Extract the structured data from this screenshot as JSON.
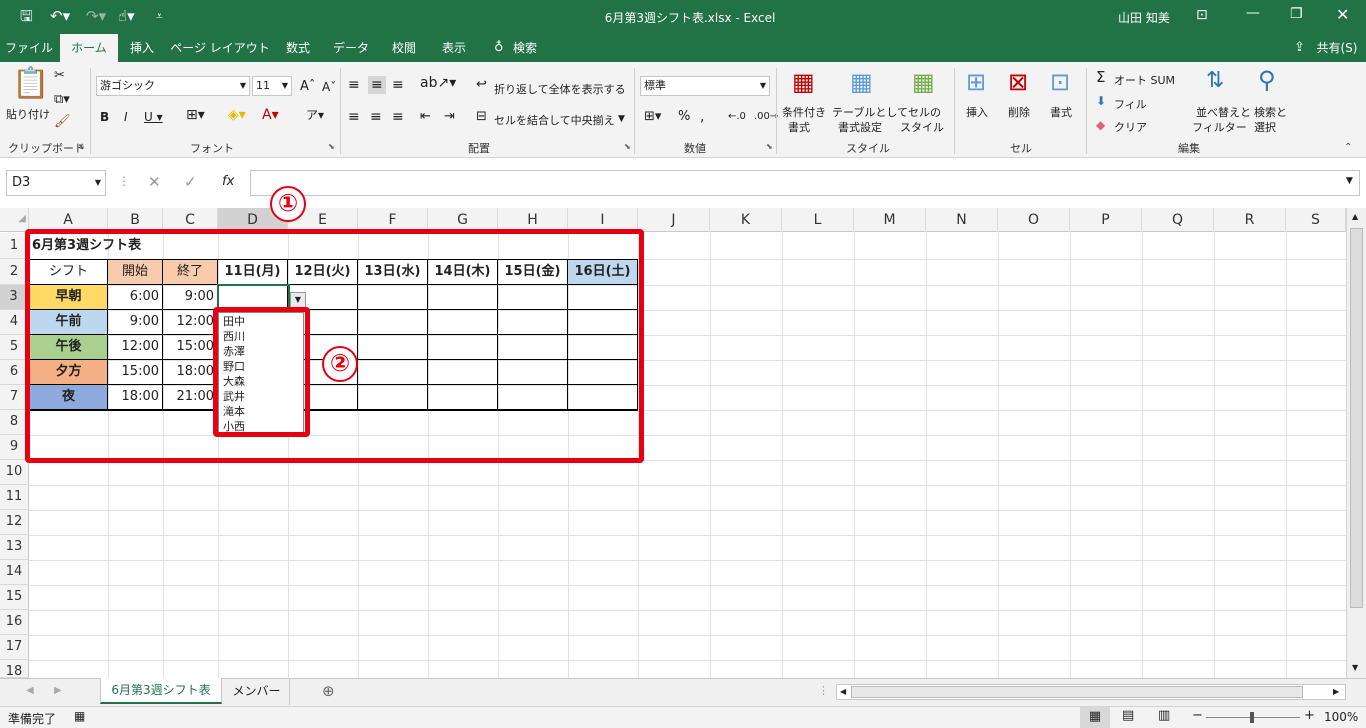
{
  "window": {
    "title": "6月第3週シフト表.xlsx  -  Excel",
    "user": "山田 知美"
  },
  "tabs": [
    "ファイル",
    "ホーム",
    "挿入",
    "ページ レイアウト",
    "数式",
    "データ",
    "校閲",
    "表示",
    "検索"
  ],
  "share": "共有(S)",
  "ribbon": {
    "clipboard": {
      "paste": "貼り付け",
      "label": "クリップボード"
    },
    "font": {
      "name": "游ゴシック",
      "size": "11",
      "label": "フォント"
    },
    "alignment": {
      "wrap": "折り返して全体を表示する",
      "merge": "セルを結合して中央揃え",
      "label": "配置"
    },
    "number": {
      "format": "標準",
      "label": "数値"
    },
    "styles": {
      "cond1": "条件付き",
      "cond2": "書式",
      "table1": "テーブルとして",
      "table2": "書式設定",
      "cell1": "セルの",
      "cell2": "スタイル",
      "label": "スタイル"
    },
    "cells": {
      "insert": "挿入",
      "delete": "削除",
      "format": "書式",
      "label": "セル"
    },
    "editing": {
      "autosum": "オート SUM",
      "fill": "フィル",
      "clear": "クリア",
      "sort1": "並べ替えと",
      "sort2": "フィルター",
      "find1": "検索と",
      "find2": "選択",
      "label": "編集"
    }
  },
  "formula_bar": {
    "name_box": "D3",
    "fx": "fx",
    "value": ""
  },
  "columns": [
    "A",
    "B",
    "C",
    "D",
    "E",
    "F",
    "G",
    "H",
    "I",
    "J",
    "K",
    "L",
    "M",
    "N",
    "O",
    "P",
    "Q",
    "R",
    "S"
  ],
  "rows": [
    "1",
    "2",
    "3",
    "4",
    "5",
    "6",
    "7",
    "8",
    "9",
    "10",
    "11",
    "12",
    "13",
    "14",
    "15",
    "16",
    "17",
    "18"
  ],
  "sheet": {
    "title": "6月第3週シフト表",
    "header": [
      "シフト",
      "開始",
      "終了",
      "11日(月)",
      "12日(火)",
      "13日(水)",
      "14日(木)",
      "15日(金)",
      "16日(土)"
    ],
    "shifts": [
      {
        "name": "早朝",
        "start": "6:00",
        "end": "9:00",
        "color": "#ffd966"
      },
      {
        "name": "午前",
        "start": "9:00",
        "end": "12:00",
        "color": "#bdd7ee"
      },
      {
        "name": "午後",
        "start": "12:00",
        "end": "15:00",
        "color": "#a9d08e"
      },
      {
        "name": "夕方",
        "start": "15:00",
        "end": "18:00",
        "color": "#f4b084"
      },
      {
        "name": "夜",
        "start": "18:00",
        "end": "21:00",
        "color": "#8ea9db"
      }
    ]
  },
  "dropdown": {
    "options": [
      "田中",
      "西川",
      "赤澤",
      "野口",
      "大森",
      "武井",
      "滝本",
      "小西"
    ]
  },
  "annotations": {
    "one": "①",
    "two": "②"
  },
  "sheet_tabs": [
    "6月第3週シフト表",
    "メンバー"
  ],
  "status": {
    "ready": "準備完了",
    "zoom": "100%"
  },
  "colors": {
    "excel_green": "#217346",
    "highlight_red": "#e60012",
    "header_pink": "#f8cbad",
    "saturday_blue": "#bdd7ee"
  }
}
